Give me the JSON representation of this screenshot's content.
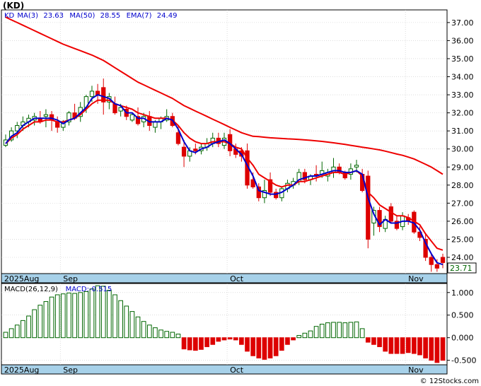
{
  "title": "(KD)",
  "footer": "© 12Stocks.com",
  "price_panel": {
    "legend": [
      {
        "label": "KD",
        "color": "#0000cc"
      },
      {
        "label": "MA(3)",
        "color": "#0000cc"
      },
      {
        "label": "23.63",
        "color": "#0000cc"
      },
      {
        "label": "MA(50)",
        "color": "#0000cc"
      },
      {
        "label": "28.55",
        "color": "#0000cc"
      },
      {
        "label": "EMA(7)",
        "color": "#0000cc"
      },
      {
        "label": "24.49",
        "color": "#0000cc"
      }
    ],
    "current_price": "23.71"
  },
  "macd_panel": {
    "legend": [
      {
        "label": "MACD(26,12,9)",
        "color": "#000000"
      },
      {
        "label": "MACD:-0.515",
        "color": "#0000cc"
      }
    ]
  },
  "x_labels": [
    "2025Aug",
    "Sep",
    "Oct",
    "Nov"
  ],
  "colors": {
    "up": "#006600",
    "down": "#dd0000",
    "ma3": "#0000cc",
    "ema7": "#ee0000",
    "ma50": "#ee0000",
    "axis_band": "#a7d1e9"
  },
  "chart_data": [
    {
      "type": "candlestick",
      "title": "(KD)",
      "y_ticks": [
        "24.00",
        "25.00",
        "26.00",
        "27.00",
        "28.00",
        "29.00",
        "30.00",
        "31.00",
        "32.00",
        "33.00",
        "34.00",
        "35.00",
        "36.00",
        "37.00"
      ],
      "ylim": [
        23.1,
        37.7
      ],
      "month_starts": {
        "Sep": 10,
        "Oct": 39,
        "Nov": 70
      },
      "candles": [
        [
          30.2,
          30.8,
          30.1,
          30.5
        ],
        [
          30.5,
          31.2,
          30.4,
          31.0
        ],
        [
          31.0,
          31.5,
          30.6,
          31.3
        ],
        [
          31.3,
          31.8,
          31.0,
          31.5
        ],
        [
          31.5,
          31.9,
          31.2,
          31.7
        ],
        [
          31.6,
          32.0,
          31.3,
          31.8
        ],
        [
          31.7,
          32.1,
          31.4,
          31.5
        ],
        [
          31.8,
          32.2,
          31.2,
          31.9
        ],
        [
          31.9,
          32.1,
          31.0,
          31.6
        ],
        [
          31.5,
          31.8,
          30.9,
          31.2
        ],
        [
          31.2,
          31.6,
          31.0,
          31.5
        ],
        [
          31.5,
          32.1,
          31.3,
          32.0
        ],
        [
          32.0,
          32.5,
          31.6,
          31.7
        ],
        [
          31.8,
          32.6,
          31.5,
          32.3
        ],
        [
          32.3,
          33.0,
          32.0,
          32.9
        ],
        [
          32.9,
          33.5,
          32.6,
          33.2
        ],
        [
          33.2,
          33.6,
          32.5,
          33.0
        ],
        [
          33.4,
          33.9,
          31.9,
          32.6
        ],
        [
          32.6,
          33.1,
          32.2,
          32.9
        ],
        [
          32.5,
          32.9,
          31.9,
          32.0
        ],
        [
          32.1,
          32.5,
          31.8,
          32.3
        ],
        [
          32.2,
          32.4,
          31.6,
          31.8
        ],
        [
          31.6,
          32.0,
          31.5,
          31.9
        ],
        [
          31.8,
          32.3,
          31.3,
          31.4
        ],
        [
          31.5,
          32.0,
          31.2,
          31.8
        ],
        [
          31.8,
          32.1,
          31.0,
          31.3
        ],
        [
          31.2,
          31.6,
          30.9,
          31.5
        ],
        [
          31.5,
          31.8,
          31.1,
          31.7
        ],
        [
          31.6,
          32.2,
          31.5,
          31.8
        ],
        [
          31.8,
          32.0,
          31.2,
          31.3
        ],
        [
          30.9,
          31.3,
          30.2,
          30.3
        ],
        [
          30.1,
          30.5,
          29.0,
          29.6
        ],
        [
          29.6,
          30.1,
          29.3,
          29.9
        ],
        [
          30.0,
          30.3,
          29.7,
          29.9
        ],
        [
          29.9,
          30.3,
          29.7,
          30.1
        ],
        [
          30.1,
          30.6,
          29.9,
          30.3
        ],
        [
          30.3,
          30.9,
          30.1,
          30.6
        ],
        [
          30.6,
          30.9,
          30.1,
          30.3
        ],
        [
          30.2,
          30.9,
          30.0,
          30.6
        ],
        [
          30.8,
          31.1,
          29.6,
          29.9
        ],
        [
          30.0,
          30.3,
          29.5,
          29.7
        ],
        [
          29.9,
          30.1,
          29.3,
          29.6
        ],
        [
          29.9,
          30.3,
          27.8,
          28.0
        ],
        [
          28.3,
          28.7,
          27.8,
          27.9
        ],
        [
          27.9,
          28.1,
          27.1,
          27.3
        ],
        [
          27.3,
          28.3,
          27.0,
          27.7
        ],
        [
          28.3,
          28.7,
          27.4,
          27.6
        ],
        [
          27.6,
          27.8,
          27.2,
          27.3
        ],
        [
          27.3,
          27.9,
          27.1,
          27.8
        ],
        [
          27.8,
          28.3,
          27.6,
          28.1
        ],
        [
          28.0,
          28.4,
          27.8,
          28.2
        ],
        [
          28.2,
          28.9,
          28.0,
          28.7
        ],
        [
          28.7,
          28.9,
          28.1,
          28.3
        ],
        [
          28.3,
          28.6,
          28.0,
          28.5
        ],
        [
          28.6,
          29.1,
          28.2,
          28.5
        ],
        [
          28.6,
          29.3,
          28.4,
          28.8
        ],
        [
          28.5,
          28.9,
          28.2,
          28.7
        ],
        [
          28.7,
          29.5,
          28.4,
          29.0
        ],
        [
          29.0,
          29.2,
          28.6,
          28.7
        ],
        [
          28.7,
          28.8,
          28.3,
          28.4
        ],
        [
          28.6,
          29.2,
          28.3,
          28.9
        ],
        [
          29.0,
          29.4,
          28.7,
          29.1
        ],
        [
          28.6,
          28.9,
          27.6,
          27.7
        ],
        [
          28.5,
          28.8,
          24.5,
          25.0
        ],
        [
          25.9,
          26.8,
          25.2,
          26.6
        ],
        [
          26.6,
          26.8,
          25.4,
          25.7
        ],
        [
          25.6,
          26.3,
          25.4,
          26.1
        ],
        [
          26.8,
          27.0,
          25.9,
          26.0
        ],
        [
          26.0,
          26.3,
          25.5,
          25.6
        ],
        [
          25.7,
          26.5,
          25.5,
          26.3
        ],
        [
          26.2,
          26.4,
          25.8,
          26.0
        ],
        [
          26.5,
          26.6,
          25.3,
          25.4
        ],
        [
          25.4,
          25.7,
          24.9,
          25.1
        ],
        [
          25.0,
          25.3,
          23.8,
          24.0
        ],
        [
          24.0,
          24.2,
          23.2,
          23.6
        ],
        [
          23.6,
          23.9,
          23.2,
          23.4
        ],
        [
          24.0,
          24.2,
          23.4,
          23.71
        ]
      ],
      "series": [
        {
          "name": "MA(3)",
          "values": [
            30.3,
            30.7,
            30.9,
            31.3,
            31.5,
            31.7,
            31.7,
            31.7,
            31.7,
            31.6,
            31.4,
            31.6,
            31.7,
            32.0,
            32.3,
            32.8,
            33.0,
            32.9,
            32.8,
            32.5,
            32.4,
            32.0,
            32.0,
            31.7,
            31.7,
            31.5,
            31.5,
            31.5,
            31.7,
            31.6,
            31.1,
            30.4,
            29.9,
            29.8,
            30.0,
            30.1,
            30.3,
            30.4,
            30.5,
            30.3,
            30.0,
            29.7,
            29.1,
            28.5,
            27.7,
            27.6,
            27.5,
            27.5,
            27.6,
            27.8,
            28.0,
            28.3,
            28.4,
            28.5,
            28.5,
            28.6,
            28.7,
            28.8,
            28.8,
            28.7,
            28.7,
            28.8,
            28.6,
            27.3,
            26.4,
            25.8,
            26.1,
            25.9,
            25.9,
            26.0,
            26.0,
            25.9,
            25.5,
            24.8,
            24.2,
            23.7,
            23.6
          ]
        },
        {
          "name": "EMA(7)",
          "values": [
            30.3,
            30.6,
            30.8,
            31.1,
            31.3,
            31.5,
            31.5,
            31.6,
            31.6,
            31.5,
            31.5,
            31.6,
            31.7,
            31.9,
            32.2,
            32.5,
            32.7,
            32.7,
            32.7,
            32.5,
            32.4,
            32.3,
            32.2,
            32.0,
            31.9,
            31.8,
            31.7,
            31.7,
            31.7,
            31.6,
            31.3,
            30.9,
            30.6,
            30.4,
            30.3,
            30.3,
            30.4,
            30.4,
            30.4,
            30.3,
            30.1,
            30.0,
            29.5,
            29.1,
            28.6,
            28.4,
            28.2,
            28.0,
            27.9,
            28.0,
            28.0,
            28.2,
            28.2,
            28.3,
            28.4,
            28.5,
            28.6,
            28.7,
            28.7,
            28.6,
            28.7,
            28.8,
            28.5,
            27.6,
            27.3,
            26.9,
            26.7,
            26.5,
            26.3,
            26.3,
            26.2,
            26.0,
            25.8,
            25.3,
            24.9,
            24.5,
            24.4
          ]
        },
        {
          "name": "MA(50)",
          "values": [
            37.3,
            37.15,
            37.0,
            36.85,
            36.7,
            36.55,
            36.4,
            36.25,
            36.1,
            35.95,
            35.8,
            35.68,
            35.56,
            35.44,
            35.32,
            35.2,
            35.05,
            34.9,
            34.7,
            34.5,
            34.3,
            34.1,
            33.9,
            33.7,
            33.55,
            33.4,
            33.25,
            33.1,
            32.95,
            32.8,
            32.6,
            32.4,
            32.25,
            32.1,
            31.95,
            31.8,
            31.65,
            31.5,
            31.35,
            31.2,
            31.05,
            30.9,
            30.8,
            30.7,
            30.68,
            30.65,
            30.62,
            30.6,
            30.58,
            30.56,
            30.55,
            30.53,
            30.5,
            30.48,
            30.45,
            30.42,
            30.38,
            30.34,
            30.3,
            30.25,
            30.2,
            30.15,
            30.1,
            30.05,
            30.0,
            29.95,
            29.88,
            29.8,
            29.72,
            29.65,
            29.55,
            29.45,
            29.3,
            29.15,
            29.0,
            28.8,
            28.6
          ]
        }
      ]
    },
    {
      "type": "bar",
      "title": "MACD(26,12,9)",
      "y_ticks": [
        "1.000",
        "0.500",
        "0.000",
        "-0.500"
      ],
      "ylim": [
        -0.6,
        1.2
      ],
      "values": [
        0.12,
        0.2,
        0.28,
        0.38,
        0.48,
        0.62,
        0.72,
        0.8,
        0.9,
        0.95,
        0.97,
        0.99,
        0.98,
        1.0,
        1.02,
        1.08,
        1.15,
        1.14,
        1.05,
        0.95,
        0.82,
        0.7,
        0.58,
        0.46,
        0.36,
        0.28,
        0.22,
        0.17,
        0.14,
        0.12,
        0.08,
        -0.25,
        -0.27,
        -0.28,
        -0.26,
        -0.2,
        -0.15,
        -0.08,
        -0.05,
        -0.03,
        -0.05,
        -0.15,
        -0.3,
        -0.4,
        -0.45,
        -0.48,
        -0.45,
        -0.4,
        -0.28,
        -0.15,
        -0.05,
        0.05,
        0.1,
        0.15,
        0.25,
        0.3,
        0.33,
        0.34,
        0.34,
        0.33,
        0.34,
        0.35,
        0.2,
        -0.1,
        -0.15,
        -0.2,
        -0.3,
        -0.35,
        -0.35,
        -0.35,
        -0.33,
        -0.35,
        -0.38,
        -0.45,
        -0.5,
        -0.55,
        -0.5
      ]
    }
  ]
}
